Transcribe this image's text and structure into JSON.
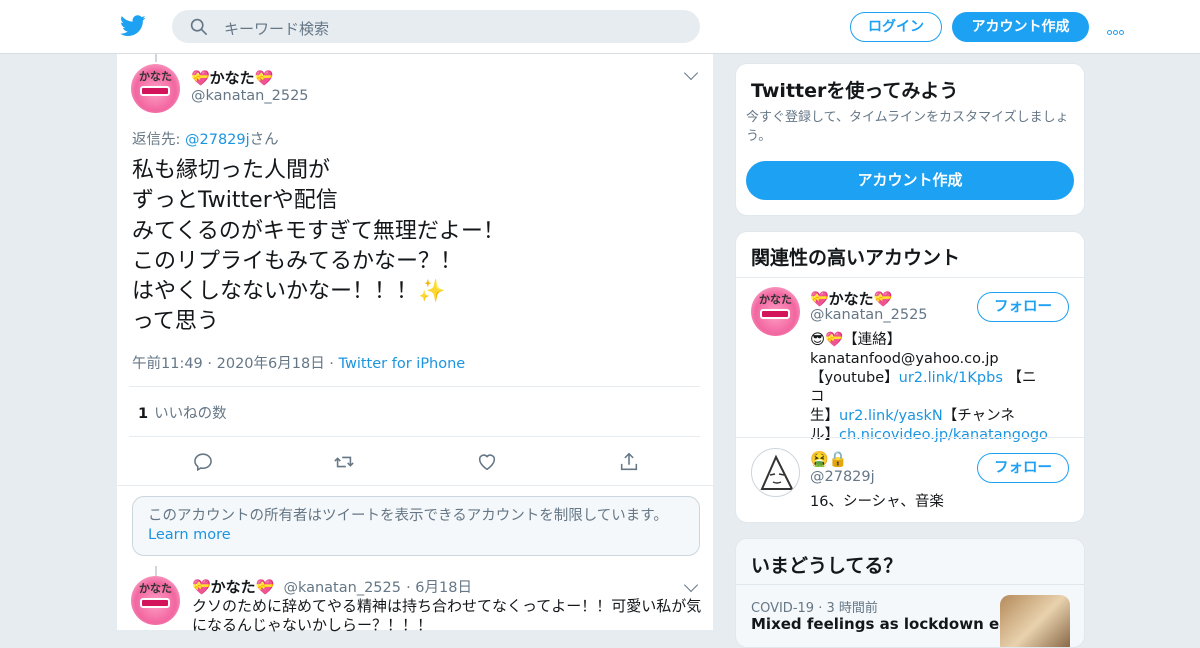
{
  "header": {
    "search_placeholder": "キーワード検索",
    "login_label": "ログイン",
    "signup_label": "アカウント作成",
    "brand_color": "#1da1f2"
  },
  "tweet": {
    "display_name": "💝かなた💝",
    "handle": "@kanatan_2525",
    "reply_prefix": "返信先: ",
    "reply_to": "@27829j",
    "reply_suffix": "さん",
    "text_lines": [
      "私も縁切った人間が",
      "ずっとTwitterや配信",
      "みてくるのがキモすぎて無理だよー！",
      "このリプライもみてるかなー？！",
      "はやくしなないかなー！！！✨",
      "って思う"
    ],
    "time": "午前11:49",
    "date": "2020年6月18日",
    "source": "Twitter for iPhone",
    "like_count": "1",
    "like_label": "いいねの数"
  },
  "notice": {
    "text": "このアカウントの所有者はツイートを表示できるアカウントを制限しています。",
    "link": "Learn more"
  },
  "reply": {
    "display_name": "💝かなた💝",
    "handle": "@kanatan_2525",
    "date": "6月18日",
    "text": "クソのために辞めてやる精神は持ち合わせてなくってよー！！可愛い私が気になるんじゃないかしらー？！！！"
  },
  "sidebar": {
    "signup_card": {
      "title": "Twitterを使ってみよう",
      "subtitle": "今すぐ登録して、タイムラインをカスタマイズしましょう。",
      "button": "アカウント作成"
    },
    "related": {
      "title": "関連性の高いアカウント",
      "follow_label": "フォロー",
      "accounts": [
        {
          "name": "💝かなた💝",
          "handle": "@kanatan_2525",
          "bio_1": "😎💝【連絡】",
          "bio_2": "kanatanfood@yahoo.co.jp",
          "bio_3a": "【youtube】",
          "bio_3b": "ur2.link/1Kpbs",
          "bio_3c": " 【ニコ",
          "bio_4a": "生】",
          "bio_4b": "ur2.link/yaskN",
          "bio_4c": "【チャンネ",
          "bio_5a": "ル】",
          "bio_5b": "ch.nicovideo.jp/kanatangogo"
        },
        {
          "name": "🤮🔒",
          "handle": "@27829j",
          "bio": "16、シーシャ、音楽"
        }
      ]
    },
    "trends": {
      "title": "いまどうしてる？",
      "category": "COVID-19",
      "time": "3 時間前",
      "headline": "Mixed feelings as lockdown eases"
    }
  }
}
